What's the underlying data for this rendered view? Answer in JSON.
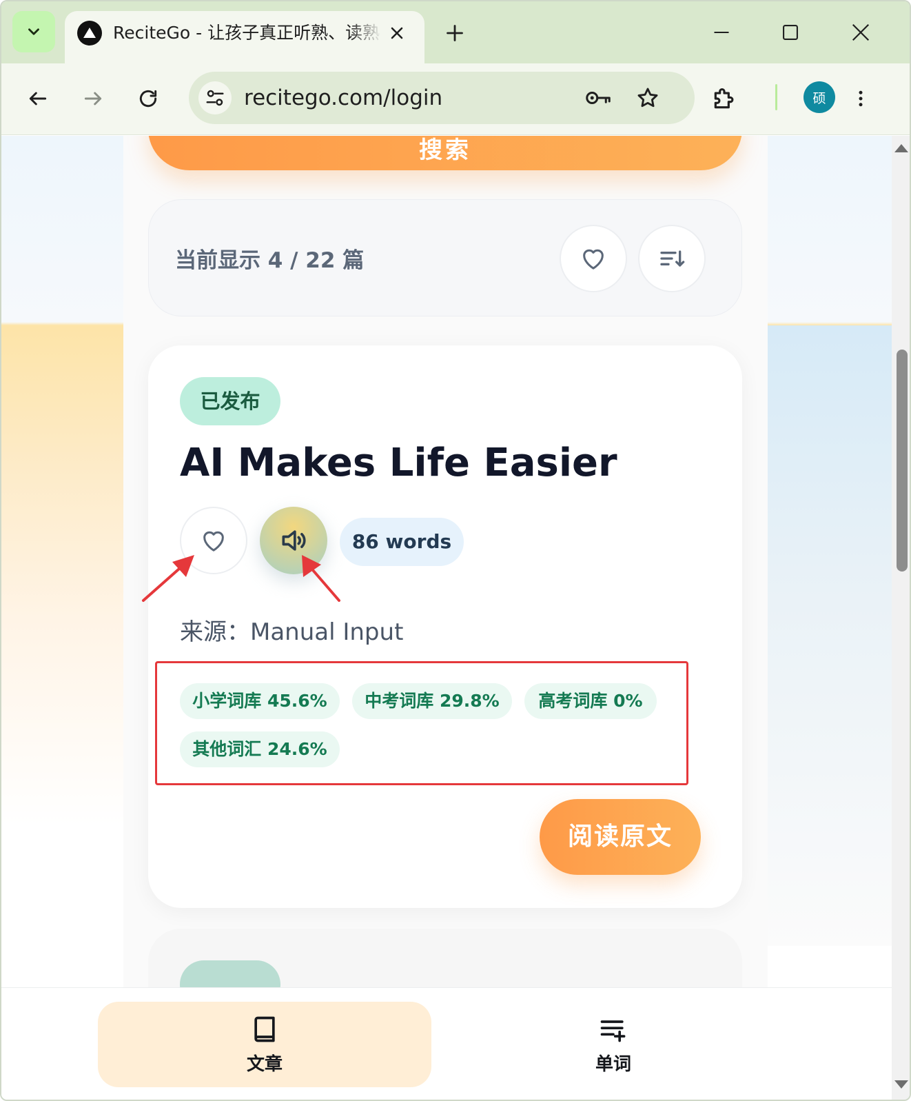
{
  "browser": {
    "tab_title": "ReciteGo - 让孩子真正听熟、读熟",
    "url": "recitego.com/login",
    "profile_initial": "硕",
    "icons": {
      "tab_menu": "chevron-down-icon",
      "tab_logo": "triangle-logo-icon",
      "close": "close-icon",
      "new_tab": "plus-icon",
      "back": "arrow-left-icon",
      "forward": "arrow-right-icon",
      "reload": "reload-icon",
      "site_info": "tune-icon",
      "password": "key-icon",
      "bookmark": "star-icon",
      "extensions": "puzzle-icon",
      "menu": "more-vertical-icon"
    }
  },
  "page": {
    "search_button_label": "搜索",
    "count_text": "当前显示 4 / 22 篇",
    "article": {
      "status": "已发布",
      "title": "AI Makes Life Easier",
      "word_count": "86 words",
      "source": "来源：Manual Input",
      "tags": [
        "小学词库 45.6%",
        "中考词库 29.8%",
        "高考词库 0%",
        "其他词汇 24.6%"
      ],
      "read_button": "阅读原文"
    }
  },
  "bottom_nav": {
    "items": [
      {
        "label": "文章",
        "icon": "book-icon",
        "active": true
      },
      {
        "label": "单词",
        "icon": "playlist-add-icon",
        "active": false
      }
    ]
  },
  "colors": {
    "accent_orange": "#fe9a48",
    "status_green": "#bdeedd",
    "tag_text_green": "#147a52",
    "highlight_red": "#e5383b",
    "browser_chrome": "#d9e8cd"
  }
}
